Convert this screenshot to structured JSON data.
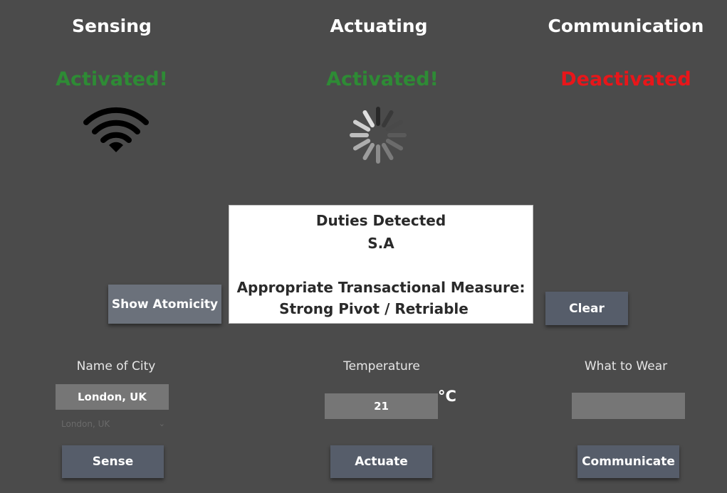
{
  "columns": [
    {
      "title": "Sensing",
      "status": "Activated!"
    },
    {
      "title": "Actuating",
      "status": "Activated!"
    },
    {
      "title": "Communication",
      "status": "Deactivated"
    }
  ],
  "colors": {
    "activated": "#2e8b35",
    "deactivated": "#e8161a",
    "background": "#4b4b4b",
    "button": "#565d6a"
  },
  "icons": {
    "sensing": "wifi-icon",
    "actuating": "loading-spinner-icon"
  },
  "dialog": {
    "title": "Duties Detected",
    "duties": "S.A",
    "measure_label": "Appropriate Transactional Measure:",
    "measure_value": "Strong Pivot / Retriable"
  },
  "buttons": {
    "show_atomicity": "Show Atomicity",
    "clear": "Clear",
    "sense": "Sense",
    "actuate": "Actuate",
    "communicate": "Communicate"
  },
  "city": {
    "label": "Name of City",
    "value": "London, UK",
    "dropdown_selected": "London, UK"
  },
  "temperature": {
    "label": "Temperature",
    "value": "21",
    "unit": "°C"
  },
  "wear": {
    "label": "What to Wear",
    "value": ""
  }
}
